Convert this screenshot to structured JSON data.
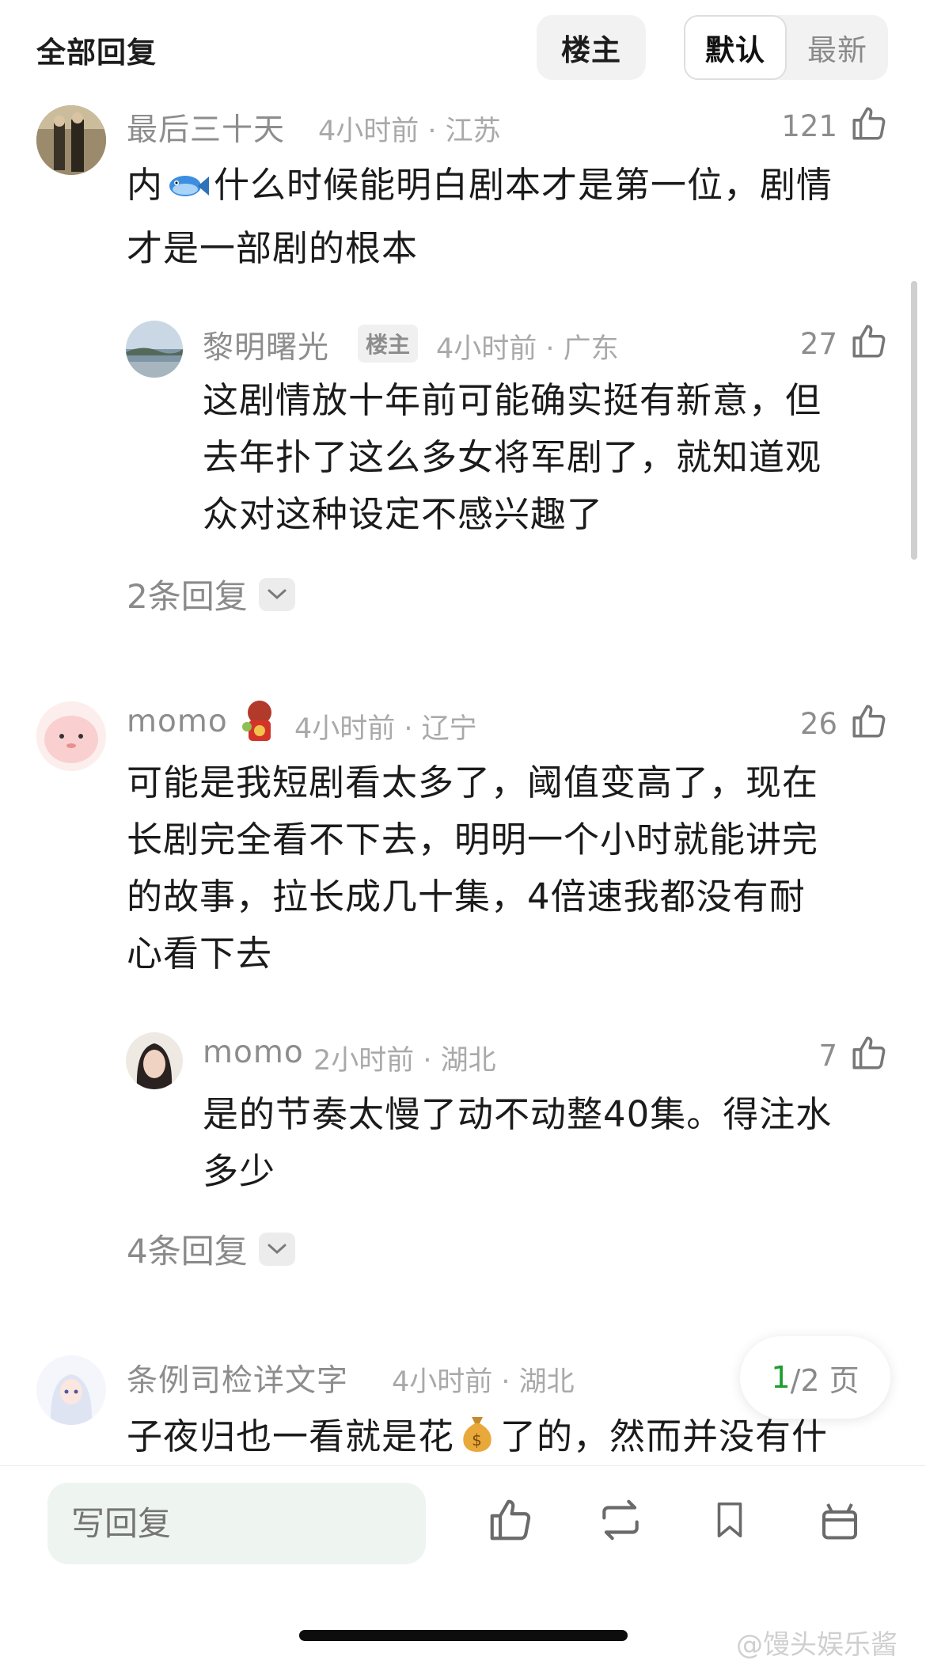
{
  "header": {
    "title": "全部回复",
    "op_button": "楼主",
    "sort_default": "默认",
    "sort_latest": "最新"
  },
  "comments": [
    {
      "name": "最后三十天",
      "meta": "4小时前 · 江苏",
      "likes": "121",
      "text_before_emoji": "内",
      "emoji": "fish",
      "text_after_emoji": "什么时候能明白剧本才是第一位，剧情",
      "text_line2": "才是一部剧的根本",
      "reply": {
        "name": "黎明曙光",
        "badge": "楼主",
        "meta": "4小时前 · 广东",
        "likes": "27",
        "lines": [
          "这剧情放十年前可能确实挺有新意，但",
          "去年扑了这么多女将军剧了，就知道观",
          "众对这种设定不感兴趣了"
        ]
      },
      "reply_count": "2条回复"
    },
    {
      "name": "momo",
      "meta": "4小时前 · 辽宁",
      "likes": "26",
      "lines": [
        "可能是我短剧看太多了，阈值变高了，现在",
        "长剧完全看不下去，明明一个小时就能讲完",
        "的故事，拉长成几十集，4倍速我都没有耐",
        "心看下去"
      ],
      "reply": {
        "name": "momo",
        "meta": "2小时前 · 湖北",
        "likes": "7",
        "lines": [
          "是的节奏太慢了动不动整40集。得注水",
          "多少"
        ]
      },
      "reply_count": "4条回复"
    },
    {
      "name": "条例司检详文字",
      "meta": "4小时前 · 湖北",
      "text_before_emoji": "子夜归也一看就是花",
      "emoji": "money-bag",
      "text_after_emoji": "了的，然而并没有什"
    }
  ],
  "pager": {
    "current": "1",
    "rest": "/2 页"
  },
  "bottom": {
    "reply_placeholder": "写回复"
  },
  "watermark": "@馒头娱乐酱",
  "colors": {
    "accent_green": "#1e9d2f",
    "muted": "#8d8d8d"
  }
}
